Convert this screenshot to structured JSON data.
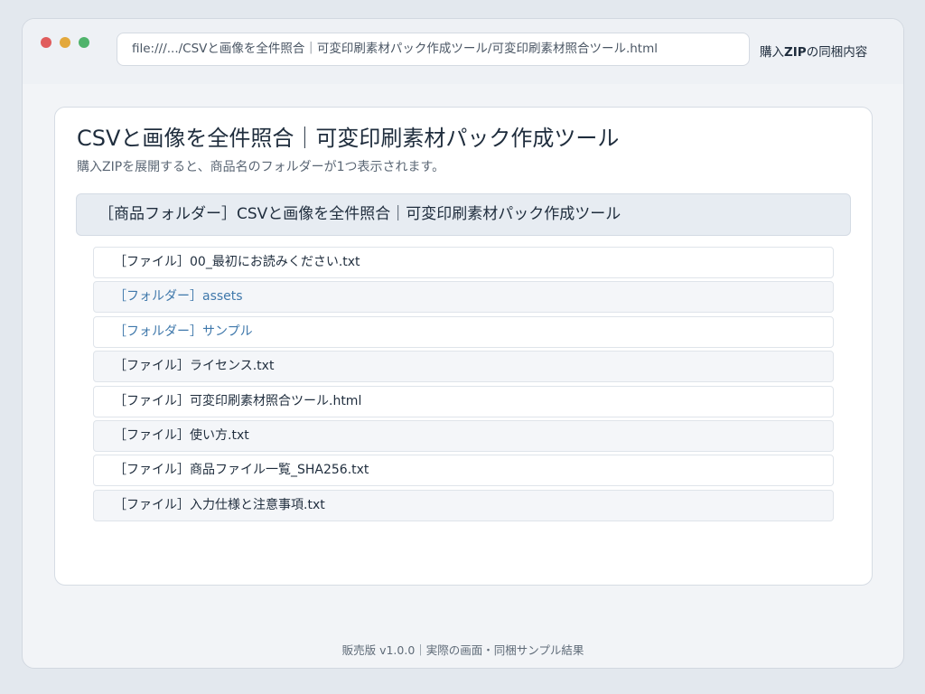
{
  "colors": {
    "close": "#e05c5c",
    "minimize": "#e3a83b",
    "maximize": "#4fb36b",
    "folder_link": "#3f78ab"
  },
  "browser": {
    "url": "file:///.../CSVと画像を全件照合｜可変印刷素材パック作成ツール/可変印刷素材照合ツール.html",
    "tab_title_prefix": "購入",
    "tab_title_bold": "ZIP",
    "tab_title_suffix": "の同梱内容"
  },
  "page": {
    "title": "CSVと画像を全件照合｜可変印刷素材パック作成ツール",
    "subtitle": "購入ZIPを展開すると、商品名のフォルダーが1つ表示されます。",
    "root_folder": "［商品フォルダー］CSVと画像を全件照合｜可変印刷素材パック作成ツール",
    "items": [
      {
        "label": "［ファイル］00_最初にお読みください.txt",
        "kind": "file"
      },
      {
        "label": "［フォルダー］assets",
        "kind": "folder"
      },
      {
        "label": "［フォルダー］サンプル",
        "kind": "folder"
      },
      {
        "label": "［ファイル］ライセンス.txt",
        "kind": "file"
      },
      {
        "label": "［ファイル］可変印刷素材照合ツール.html",
        "kind": "file"
      },
      {
        "label": "［ファイル］使い方.txt",
        "kind": "file"
      },
      {
        "label": "［ファイル］商品ファイル一覧_SHA256.txt",
        "kind": "file"
      },
      {
        "label": "［ファイル］入力仕様と注意事項.txt",
        "kind": "file"
      }
    ]
  },
  "footer": {
    "text": "販売版 v1.0.0｜実際の画面・同梱サンプル結果"
  }
}
